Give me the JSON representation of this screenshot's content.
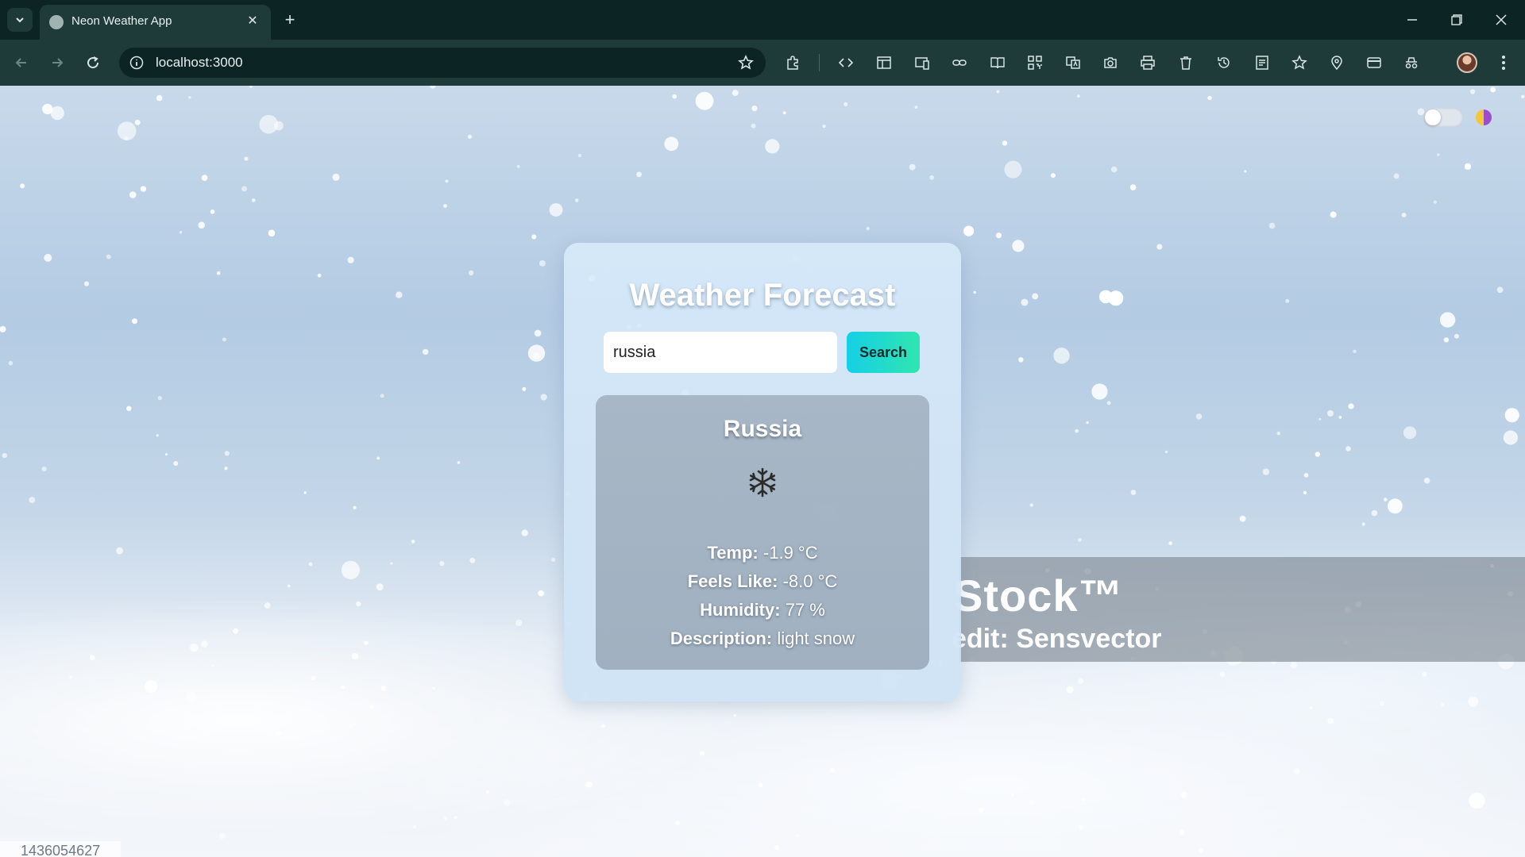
{
  "browser": {
    "tab_title": "Neon Weather App",
    "url": "localhost:3000"
  },
  "watermark": {
    "logo": "Stock™",
    "credit": "edit: Sensvector",
    "id": "1436054627"
  },
  "app": {
    "title": "Weather Forecast",
    "search": {
      "value": "russia",
      "button_label": "Search"
    },
    "result": {
      "city": "Russia",
      "icon": "snowflake-icon",
      "temp_label": "Temp:",
      "temp_value": "-1.9 °C",
      "feels_label": "Feels Like:",
      "feels_value": "-8.0 °C",
      "humidity_label": "Humidity:",
      "humidity_value": "77 %",
      "description_label": "Description:",
      "description_value": "light snow"
    },
    "theme_toggle": {
      "on": false
    }
  }
}
